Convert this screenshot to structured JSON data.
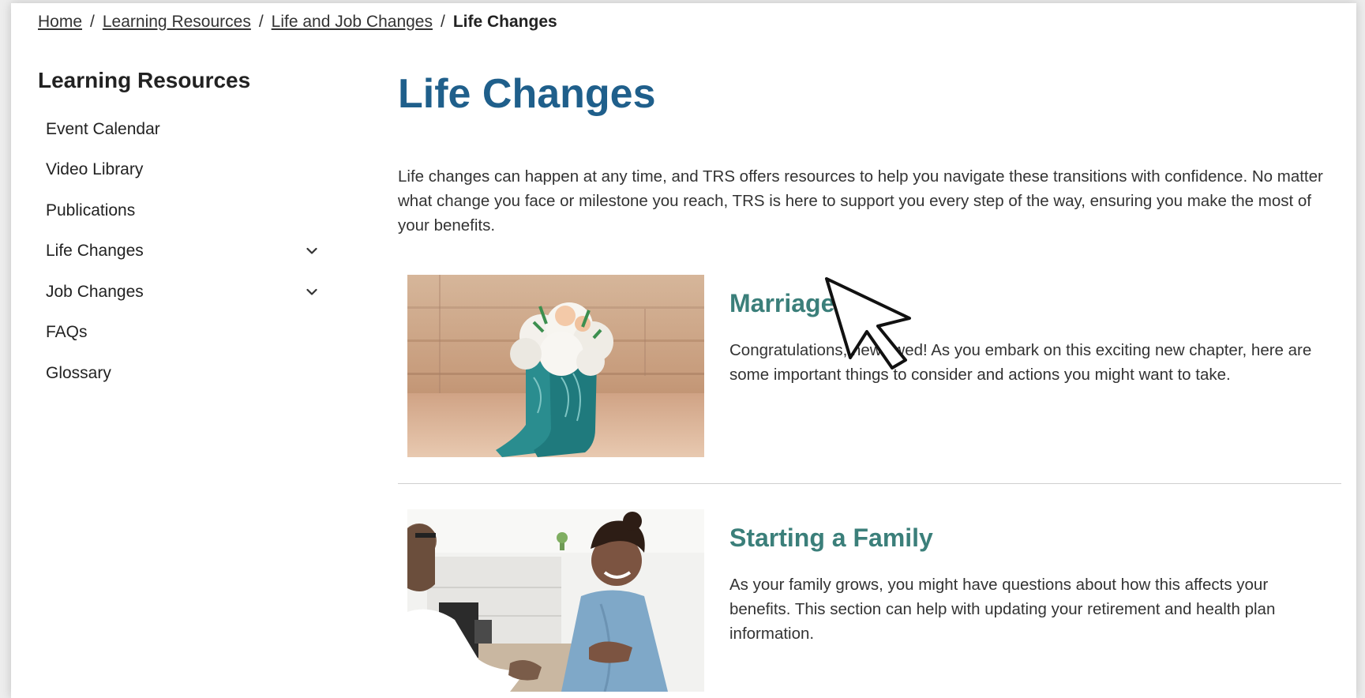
{
  "breadcrumb": {
    "items": [
      "Home",
      "Learning Resources",
      "Life and Job Changes"
    ],
    "current": "Life Changes",
    "separator": "/"
  },
  "sidebar": {
    "title": "Learning Resources",
    "items": [
      {
        "label": "Event Calendar"
      },
      {
        "label": "Video Library"
      },
      {
        "label": "Publications"
      },
      {
        "label": "Life Changes",
        "icon": "chevron-down-icon"
      },
      {
        "label": "Job Changes",
        "icon": "chevron-down-icon"
      },
      {
        "label": "FAQs"
      },
      {
        "label": "Glossary"
      }
    ]
  },
  "main": {
    "title": "Life Changes",
    "intro": "Life changes can happen at any time, and TRS offers resources to help you navigate these transitions with confidence. No matter what change you face or milestone you reach, TRS is here to support you every step of the way, ensuring you make the most of your benefits.",
    "cards": [
      {
        "title": "Marriage",
        "description": "Congratulations, newlywed! As you embark on this exciting new chapter, here are some important things to consider and actions you might want to take."
      },
      {
        "title": "Starting a Family",
        "description": "As your family grows, you might have questions about how this affects your benefits. This section can help with updating your retirement and health plan information."
      }
    ]
  },
  "colors": {
    "page_title": "#1f5f8b",
    "card_title": "#3b7f7a",
    "text": "#333333"
  }
}
